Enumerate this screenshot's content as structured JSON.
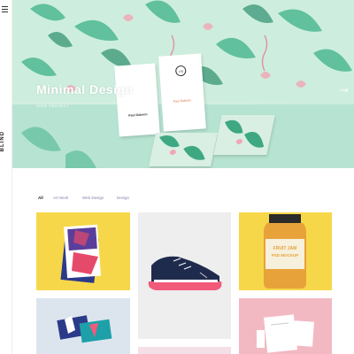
{
  "sidebar": {
    "brand": "BLIND"
  },
  "hero": {
    "title": "Minimal Design",
    "link": "VIEW PROJECT",
    "card_left_name": "Paul Dobson",
    "card_right_name": "Paul Dobson",
    "card_monogram": "PD"
  },
  "filters": [
    "All",
    "Art Work",
    "Web Design",
    "Design"
  ],
  "portfolio": {
    "jar_label_top": "FRUIT JAM",
    "jar_label_main": "PSD MOCKUP"
  },
  "colors": {
    "hero_mint": "#bfe8d6",
    "tile_yellow": "#f7d74a",
    "tile_pink": "#f3b9c3",
    "tile_gray": "#eeeeee",
    "tile_lightblue": "#dce5ee",
    "accent_purple": "#8b7fae"
  }
}
